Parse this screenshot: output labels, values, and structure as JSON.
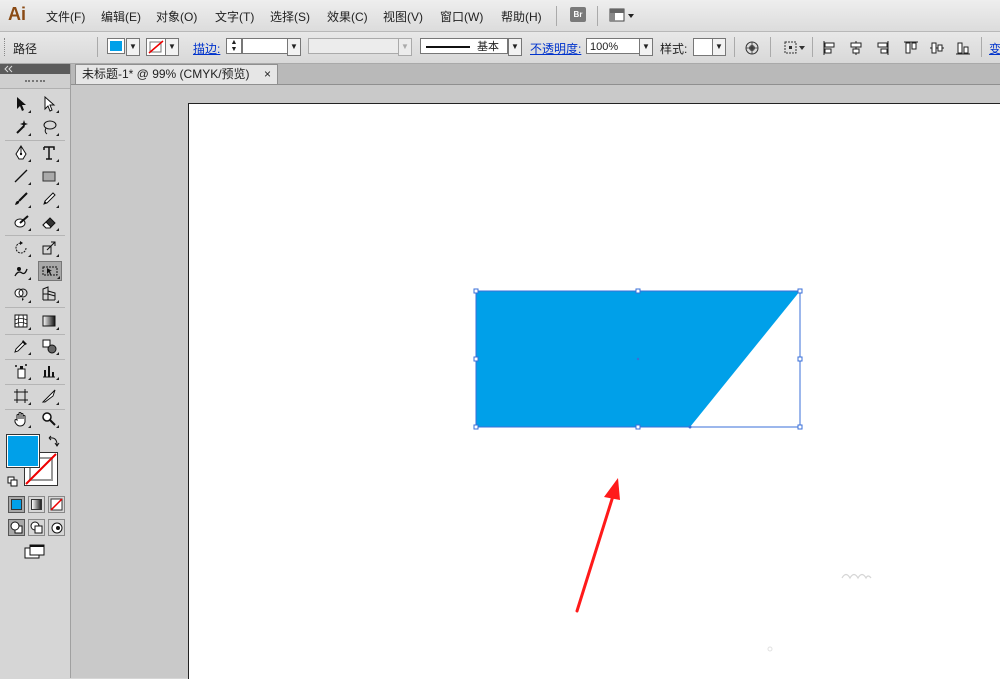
{
  "app": {
    "logo": "Ai"
  },
  "menubar": {
    "items": [
      "文件(F)",
      "编辑(E)",
      "对象(O)",
      "文字(T)",
      "选择(S)",
      "效果(C)",
      "视图(V)",
      "窗口(W)",
      "帮助(H)"
    ],
    "bridge_label": "Br"
  },
  "control": {
    "selection_type": "路径",
    "fill_color": "#00a0e9",
    "stroke_label": "描边:",
    "stroke_profile": "基本",
    "opacity_label": "不透明度:",
    "opacity_value": "100%",
    "style_label": "样式:",
    "transform_label": "变"
  },
  "document": {
    "tab_title": "未标题-1* @ 99% (CMYK/预览)",
    "close_glyph": "×"
  },
  "tools": {
    "fill_color": "#00a0e9",
    "active_tool": "free-transform-tool"
  },
  "artwork": {
    "shape_color": "#00a0e9",
    "selection_color": "#3a6fd8",
    "arrow_color": "#ff1a1a"
  }
}
